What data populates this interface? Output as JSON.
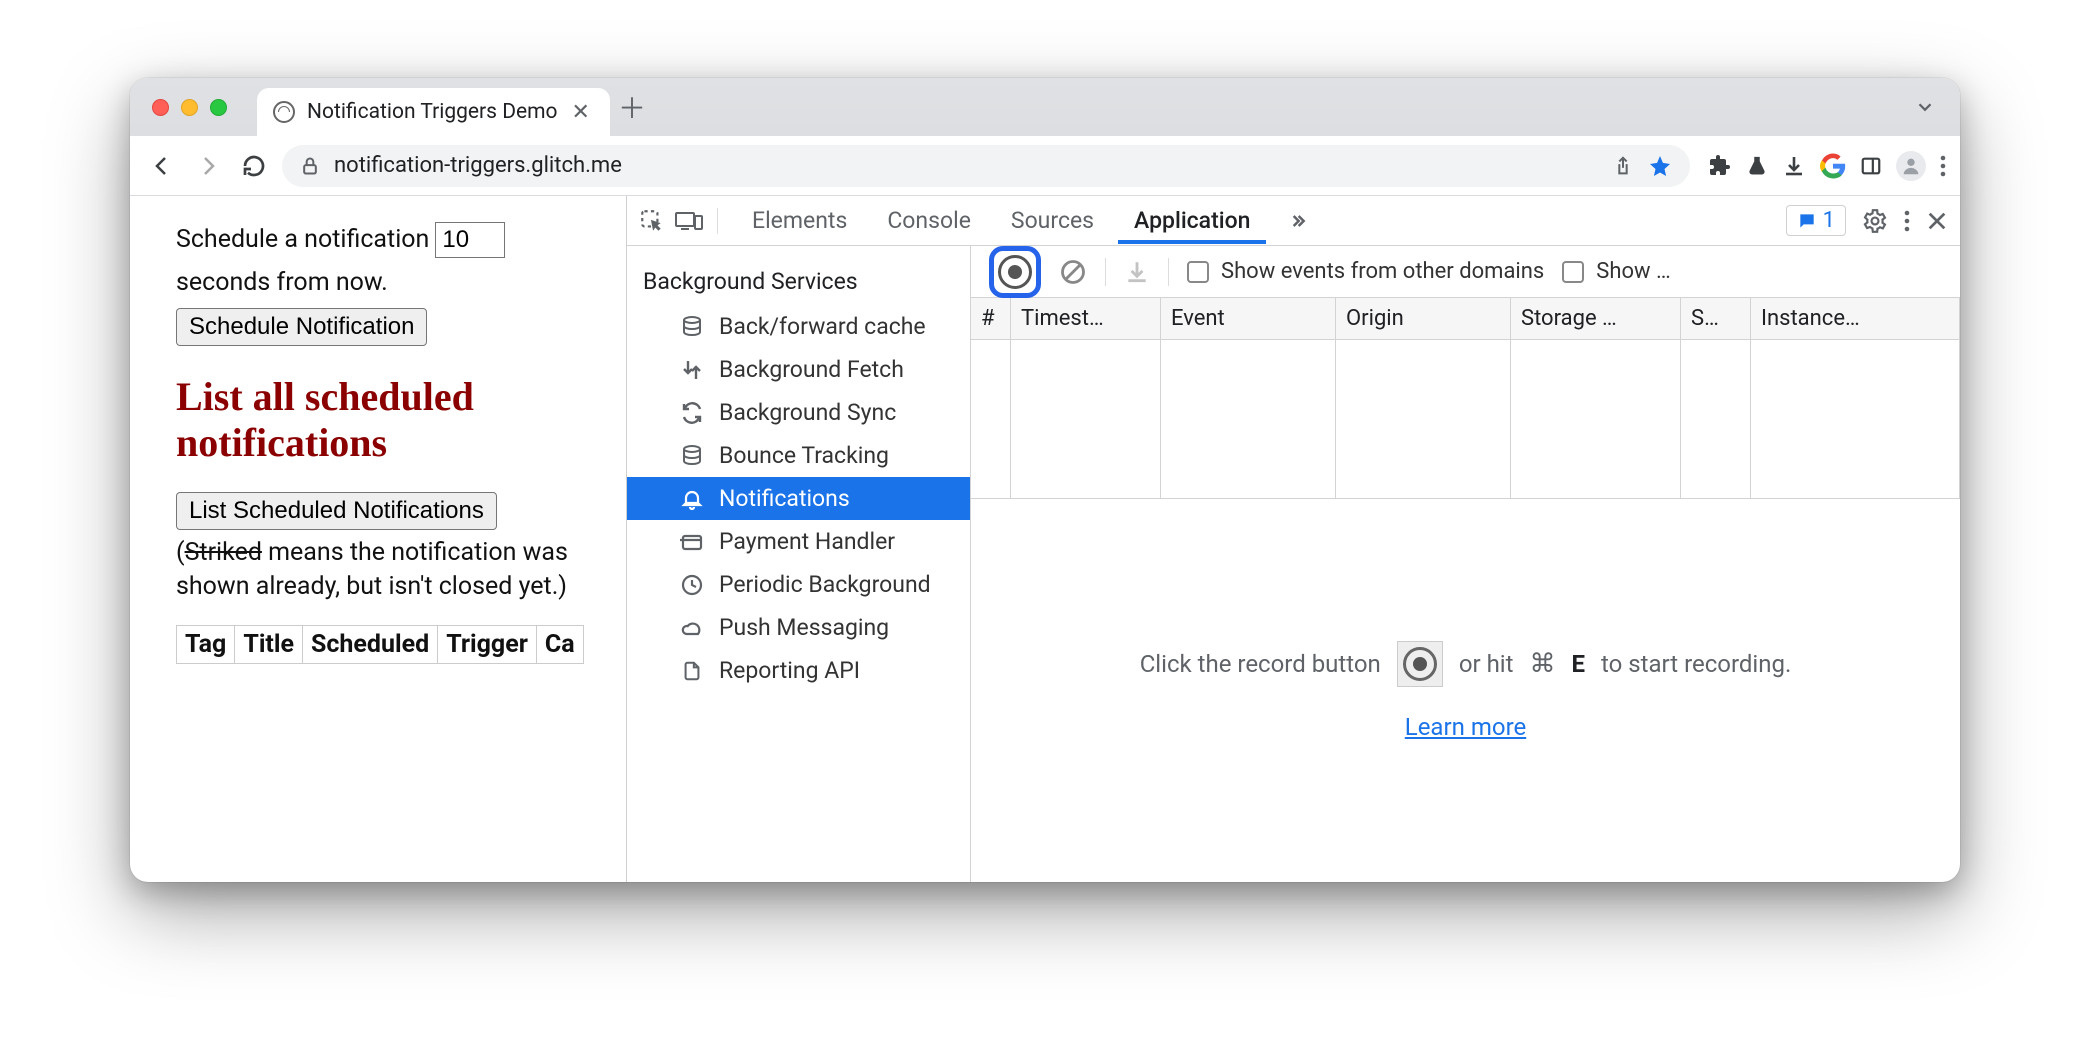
{
  "browser": {
    "tab_title": "Notification Triggers Demo",
    "url_host": "notification-triggers.glitch.me",
    "url_path": ""
  },
  "page": {
    "schedule_label_pre": "Schedule a notification",
    "schedule_input_value": "10",
    "schedule_label_post": "seconds from now.",
    "schedule_button": "Schedule Notification",
    "heading": "List all scheduled notifications",
    "list_button": "List Scheduled Notifications",
    "note_open": "(",
    "note_striked": "Striked",
    "note_rest": " means the notification was shown already, but isn't closed yet.)",
    "columns": [
      "Tag",
      "Title",
      "Scheduled",
      "Trigger",
      "Ca"
    ]
  },
  "devtools": {
    "tabs": [
      "Elements",
      "Console",
      "Sources",
      "Application"
    ],
    "active_tab": "Application",
    "issues_count": "1",
    "sidebar": {
      "group": "Background Services",
      "items": [
        {
          "label": "Back/forward cache",
          "icon": "db"
        },
        {
          "label": "Background Fetch",
          "icon": "fetch"
        },
        {
          "label": "Background Sync",
          "icon": "sync"
        },
        {
          "label": "Bounce Tracking",
          "icon": "db"
        },
        {
          "label": "Notifications",
          "icon": "bell",
          "selected": true
        },
        {
          "label": "Payment Handler",
          "icon": "card"
        },
        {
          "label": "Periodic Background",
          "icon": "clock"
        },
        {
          "label": "Push Messaging",
          "icon": "cloud"
        },
        {
          "label": "Reporting API",
          "icon": "doc"
        }
      ]
    },
    "toolbar": {
      "show_other_domains": "Show events from other domains",
      "show_more": "Show …"
    },
    "columns": {
      "num": "#",
      "timestamp": "Timest…",
      "event": "Event",
      "origin": "Origin",
      "storage": "Storage …",
      "sw": "S…",
      "instance": "Instance…"
    },
    "helper": {
      "line_pre": "Click the record button",
      "line_mid": "or hit",
      "shortcut_mod": "⌘",
      "shortcut_key": "E",
      "line_post": "to start recording.",
      "learn_more": "Learn more"
    }
  }
}
